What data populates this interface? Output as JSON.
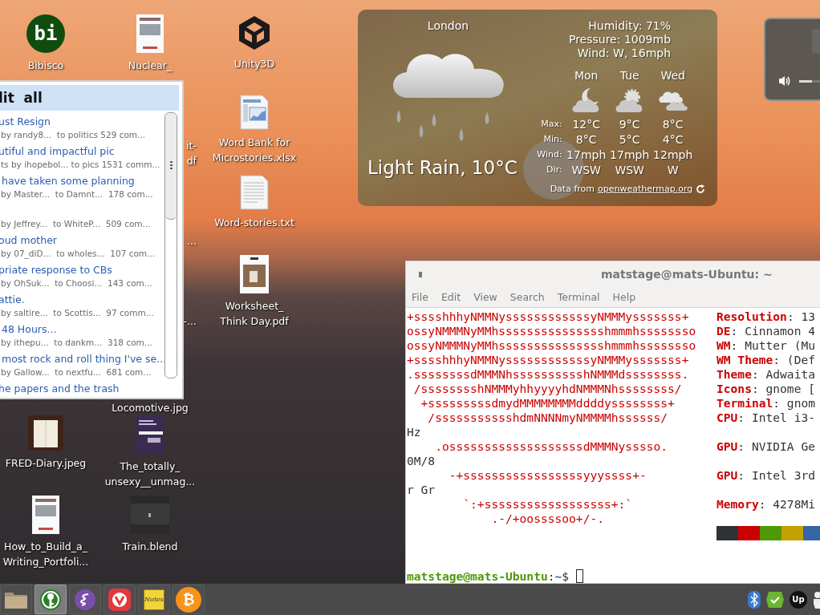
{
  "desktop_icons": [
    {
      "kind": "bibisco",
      "lines": [
        "Bibisco"
      ],
      "badge": "bi"
    },
    {
      "kind": "doc-thumb",
      "lines": [
        "Nuclear_"
      ]
    },
    {
      "kind": "unity",
      "lines": [
        "Unity3D"
      ]
    },
    {
      "kind": "fragment",
      "lines": [
        "it-",
        "df"
      ]
    },
    {
      "kind": "spreadsheet",
      "lines": [
        "Word Bank for",
        "Microstories.xlsx"
      ]
    },
    {
      "kind": "fragment",
      "lines": [
        "..."
      ]
    },
    {
      "kind": "text-file",
      "lines": [
        "Word-stories.txt"
      ]
    },
    {
      "kind": "fragment",
      "lines": [
        "-..."
      ]
    },
    {
      "kind": "photo-doc",
      "lines": [
        "Worksheet_",
        "Think Day.pdf"
      ]
    },
    {
      "kind": "label-only",
      "lines": [
        "Locomotive.jpg"
      ]
    },
    {
      "kind": "photo-brown",
      "lines": [
        "FRED-Diary.jpeg"
      ]
    },
    {
      "kind": "purple-doc",
      "lines": [
        "The_totally_",
        "unsexy__unmag..."
      ]
    },
    {
      "kind": "doc-thumb",
      "lines": [
        "How_to_Build_a_",
        "Writing_Portfoli..."
      ]
    },
    {
      "kind": "dark-photo",
      "lines": [
        "Train.blend"
      ]
    }
  ],
  "reddit_window": {
    "title": "lit  all",
    "posts": [
      {
        "title": "ust Resign",
        "meta": "by randy8...  to politics 529 com..."
      },
      {
        "title": "utiful and impactful pic",
        "meta": "ts by ihopebol... to pics 1531 comm..."
      },
      {
        "title": " have taken some planning",
        "meta": "by Master...  to Damnt...  178 com..."
      },
      {
        "meta": "by Jeffrey...  to WhiteP...  509 com..."
      },
      {
        "title": "oud mother",
        "meta": "by 07_diD...  to wholes...  107 com..."
      },
      {
        "title": "priate response to CBs",
        "meta": "by OhSuk...  to Choosi...  143 com..."
      },
      {
        "title": "attie.",
        "meta": "by saltire...  to Scottis...  97 comm..."
      },
      {
        "title": " 48 Hours...",
        "meta": "by ithepu...  to dankm...  318 com..."
      },
      {
        "title": " most rock and roll thing I've se...",
        "meta": "by Gallow...  to nextfu...  681 com..."
      },
      {
        "title": "he papers and the trash"
      }
    ]
  },
  "weather": {
    "city": "London",
    "condition": "Light Rain, 10°C",
    "details": [
      "Humidity: 71%",
      "Pressure: 1009mb",
      "Wind: W, 16mph"
    ],
    "row_labels": [
      "Max:",
      "Min:",
      "Wind:",
      "Dir:"
    ],
    "days": [
      {
        "day": "Mon",
        "kind": "moon-cloud",
        "max": "12°C",
        "min": "8°C",
        "wind": "17mph",
        "dir": "WSW"
      },
      {
        "day": "Tue",
        "kind": "sun-cloud",
        "max": "9°C",
        "min": "5°C",
        "wind": "17mph",
        "dir": "WSW"
      },
      {
        "day": "Wed",
        "kind": "clouds",
        "max": "8°C",
        "min": "4°C",
        "wind": "12mph",
        "dir": "W"
      }
    ],
    "source_prefix": "Data from",
    "source_link": "openweathermap.org"
  },
  "volume": {
    "level": 0.2
  },
  "terminal": {
    "title": "matstage@mats-Ubuntu: ~",
    "menu": [
      "File",
      "Edit",
      "View",
      "Search",
      "Terminal",
      "Help"
    ],
    "rows": [
      {
        "left": "+sssshhhyNMMNyssssssssssssyNMMMysssssss+",
        "kind": "logo",
        "key": "Resolution",
        "rest": ": 13"
      },
      {
        "left": "ossyNMMMNyMMhssssssssssssssshmmmhssssssso",
        "kind": "logo",
        "key": "DE",
        "rest": ": Cinnamon 4"
      },
      {
        "left": "ossyNMMMNyMMhssssssssssssssshmmmhssssssso",
        "kind": "logo",
        "key": "WM",
        "rest": ": Mutter (Mu"
      },
      {
        "left": "+sssshhhyNMMNyssssssssssssyNMMMysssssss+",
        "kind": "logo",
        "key": "WM Theme",
        "rest": ": (Def"
      },
      {
        "left": ".ssssssssdMMMNhsssssssssshNMMMdssssssss.",
        "kind": "logo",
        "key": "Theme",
        "rest": ": Adwaita"
      },
      {
        "left": " /sssssssshNMMMyhhyyyyhdNMMMNhssssssss/",
        "kind": "logo",
        "key": "Icons",
        "rest": ": gnome ["
      },
      {
        "left": "  +sssssssssdmydMMMMMMMMddddyssssssss+",
        "kind": "logo",
        "key": "Terminal",
        "rest": ": gnom"
      },
      {
        "left": "   /ssssssssssshdmNNNNmyNMMMMhssssss/",
        "kind": "logo",
        "key": "CPU",
        "rest": ": Intel i3-"
      },
      {
        "left": "Hz",
        "kind": "plain"
      },
      {
        "left": "    .osssssssssssssssssssdMMMNysssso.",
        "kind": "logo",
        "key": "GPU",
        "rest": ": NVIDIA Ge"
      },
      {
        "left": "0M/8",
        "kind": "plain"
      },
      {
        "left": "      -+sssssssssssssssssyyyssss+-",
        "kind": "logo",
        "key": "GPU",
        "rest": ": Intel 3rd"
      },
      {
        "left": "r Gr",
        "kind": "plain"
      },
      {
        "left": "        `:+ssssssssssssssssss+:`",
        "kind": "logo",
        "key": "Memory",
        "rest": ": 4278Mi"
      },
      {
        "left": "            .-/+oossssoo+/-.",
        "kind": "logo"
      }
    ],
    "palette": [
      {
        "color": "#2e3436"
      },
      {
        "color": "#cc0000"
      },
      {
        "color": "#4e9a06"
      },
      {
        "color": "#c4a000"
      },
      {
        "color": "#3465a4"
      }
    ],
    "prompt": [
      {
        "text": "matstage@mats-Ubuntu",
        "kind": "user"
      },
      {
        "text": ":",
        "kind": "plain"
      },
      {
        "text": "~",
        "kind": "path"
      },
      {
        "text": "$",
        "kind": "plain"
      }
    ]
  },
  "taskbar": {
    "launchers": [
      {
        "kind": "folder",
        "selected": false
      },
      {
        "kind": "keepass",
        "selected": true
      },
      {
        "kind": "emacs",
        "selected": false
      },
      {
        "kind": "vivaldi",
        "selected": false
      },
      {
        "kind": "notes",
        "selected": false,
        "text": "Notes"
      },
      {
        "kind": "bitcoin",
        "selected": false,
        "text": "₿"
      }
    ],
    "tray": [
      {
        "kind": "bluetooth"
      },
      {
        "kind": "check"
      },
      {
        "kind": "upwork",
        "text": "Up"
      },
      {
        "kind": "person"
      }
    ]
  }
}
